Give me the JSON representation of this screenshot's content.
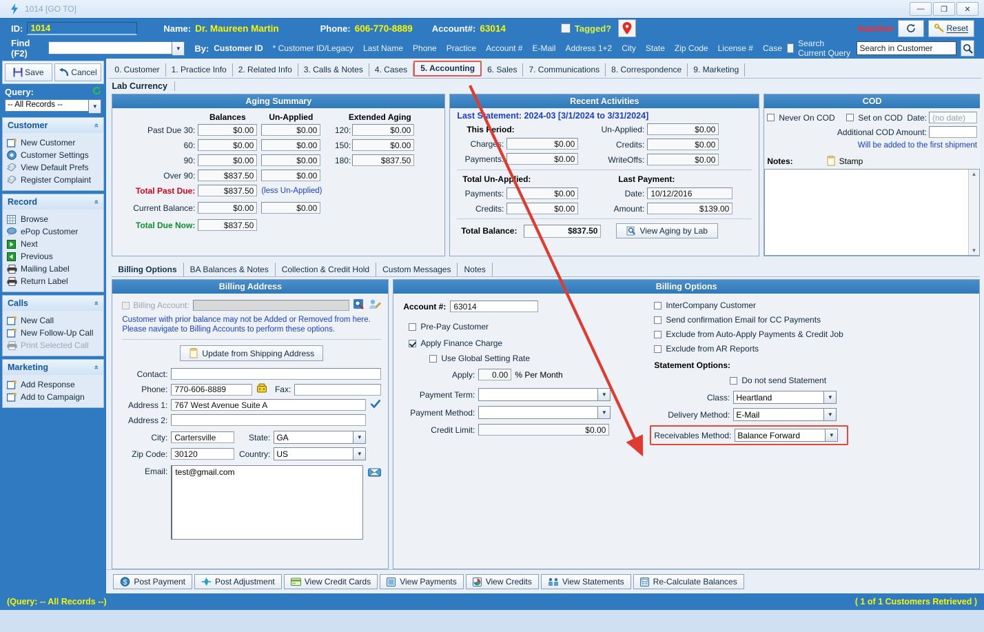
{
  "window": {
    "title": "1014 [GO TO]",
    "minimize": "—",
    "maximize": "❐",
    "close": "✕"
  },
  "header": {
    "id_label": "ID:",
    "id_value": "1014",
    "name_label": "Name:",
    "name_value": "Dr. Maureen Martin",
    "phone_label": "Phone:",
    "phone_value": "606-770-8889",
    "account_label": "Account#:",
    "account_value": "63014",
    "tagged_label": "Tagged?",
    "map_icon": "map-pin-icon",
    "status": "Inactive",
    "refresh_icon": "refresh-icon",
    "reset_label": "Reset"
  },
  "findbar": {
    "find_label": "Find (F2)",
    "find_value": "",
    "by_label": "By:",
    "by_options": [
      "Customer ID",
      "* Customer ID/Legacy",
      "Last Name",
      "Phone",
      "Practice",
      "Account #",
      "E-Mail",
      "Address 1+2",
      "City",
      "State",
      "Zip Code",
      "License #",
      "Case"
    ],
    "by_selected": "Customer ID",
    "search_current_query_label": "Search Current Query",
    "search_value": "Search in Customer",
    "search_icon": "magnifier-icon"
  },
  "sidebar": {
    "save_label": "Save",
    "cancel_label": "Cancel",
    "query_label": "Query:",
    "query_refresh_icon": "refresh-icon",
    "query_value": "-- All Records --",
    "groups": [
      {
        "title": "Customer",
        "items": [
          {
            "label": "New Customer",
            "icon": "new-page-icon",
            "dim": false
          },
          {
            "label": "Customer Settings",
            "icon": "gear-blue-icon",
            "dim": false
          },
          {
            "label": "View Default Prefs",
            "icon": "pages-icon",
            "dim": false
          },
          {
            "label": "Register Complaint",
            "icon": "pages-icon",
            "dim": false
          }
        ]
      },
      {
        "title": "Record",
        "items": [
          {
            "label": "Browse",
            "icon": "grid-icon",
            "dim": false
          },
          {
            "label": "ePop Customer",
            "icon": "speech-bubble-icon",
            "dim": false
          },
          {
            "label": "Next",
            "icon": "next-arrow-icon",
            "dim": false
          },
          {
            "label": "Previous",
            "icon": "previous-arrow-icon",
            "dim": false
          },
          {
            "label": "Mailing Label",
            "icon": "printer-icon",
            "dim": false
          },
          {
            "label": "Return Label",
            "icon": "printer-icon",
            "dim": false
          }
        ]
      },
      {
        "title": "Calls",
        "items": [
          {
            "label": "New Call",
            "icon": "new-page-icon",
            "dim": false
          },
          {
            "label": "New Follow-Up Call",
            "icon": "new-page-icon",
            "dim": false
          },
          {
            "label": "Print Selected Call",
            "icon": "printer-icon",
            "dim": true
          }
        ]
      },
      {
        "title": "Marketing",
        "items": [
          {
            "label": "Add Response",
            "icon": "new-page-icon",
            "dim": false
          },
          {
            "label": "Add to Campaign",
            "icon": "new-page-icon",
            "dim": false
          }
        ]
      }
    ]
  },
  "tabs": [
    {
      "label": "0. Customer",
      "active": false
    },
    {
      "label": "1. Practice Info",
      "active": false
    },
    {
      "label": "2. Related Info",
      "active": false
    },
    {
      "label": "3. Calls & Notes",
      "active": false
    },
    {
      "label": "4. Cases",
      "active": false
    },
    {
      "label": "5. Accounting",
      "active": true
    },
    {
      "label": "6. Sales",
      "active": false
    },
    {
      "label": "7. Communications",
      "active": false
    },
    {
      "label": "8. Correspondence",
      "active": false
    },
    {
      "label": "9. Marketing",
      "active": false
    }
  ],
  "lab_currency_tab": "Lab Currency",
  "aging": {
    "title": "Aging Summary",
    "col_balances": "Balances",
    "col_unapplied": "Un-Applied",
    "col_extended": "Extended Aging",
    "rows": [
      {
        "label": "Past Due 30:",
        "balance": "$0.00",
        "unapplied": "$0.00"
      },
      {
        "label": "60:",
        "balance": "$0.00",
        "unapplied": "$0.00"
      },
      {
        "label": "90:",
        "balance": "$0.00",
        "unapplied": "$0.00"
      },
      {
        "label": "Over 90:",
        "balance": "$837.50",
        "unapplied": "$0.00"
      }
    ],
    "extended": [
      {
        "label": "120:",
        "value": "$0.00"
      },
      {
        "label": "150:",
        "value": "$0.00"
      },
      {
        "label": "180:",
        "value": "$837.50"
      }
    ],
    "total_past_due_label": "Total Past Due:",
    "total_past_due_value": "$837.50",
    "less_unapplied_note": "(less Un-Applied)",
    "current_balance_label": "Current Balance:",
    "current_balance_value": "$0.00",
    "current_balance_unapplied": "$0.00",
    "total_due_now_label": "Total Due Now:",
    "total_due_now_value": "$837.50"
  },
  "recent": {
    "title": "Recent Activities",
    "last_statement": "Last Statement: 2024-03  [3/1/2024 to 3/31/2024]",
    "this_period_label": "This Period:",
    "charges_label": "Charges:",
    "charges_value": "$0.00",
    "payments_label": "Payments:",
    "payments_value": "$0.00",
    "unapplied_label": "Un-Applied:",
    "unapplied_value": "$0.00",
    "credits_label": "Credits:",
    "credits_value": "$0.00",
    "writeoffs_label": "WriteOffs:",
    "writeoffs_value": "$0.00",
    "total_unapplied_label": "Total Un-Applied:",
    "tu_payments_label": "Payments:",
    "tu_payments_value": "$0.00",
    "tu_credits_label": "Credits:",
    "tu_credits_value": "$0.00",
    "last_payment_label": "Last Payment:",
    "lp_date_label": "Date:",
    "lp_date_value": "10/12/2016",
    "lp_amount_label": "Amount:",
    "lp_amount_value": "$139.00",
    "total_balance_label": "Total Balance:",
    "total_balance_value": "$837.50",
    "view_aging_label": "View Aging by Lab"
  },
  "cod": {
    "title": "COD",
    "never_on_cod": "Never On COD",
    "set_on_cod": "Set on COD",
    "date_label": "Date:",
    "date_value": "(no date)",
    "additional_label": "Additional COD Amount:",
    "additional_value": "",
    "note": "Will be added to the first shipment",
    "notes_label": "Notes:",
    "stamp_label": "Stamp",
    "notes_value": ""
  },
  "subtabs": [
    {
      "label": "Billing Options",
      "active": true
    },
    {
      "label": "BA Balances & Notes",
      "active": false
    },
    {
      "label": "Collection & Credit Hold",
      "active": false
    },
    {
      "label": "Custom Messages",
      "active": false
    },
    {
      "label": "Notes",
      "active": false
    }
  ],
  "billing_address": {
    "title": "Billing Address",
    "billing_account_label": "Billing Account:",
    "billing_account_value": "",
    "icon1": "search-customer-icon",
    "icon2": "person-edit-icon",
    "warning_line1": "Customer with prior balance may not be Added or Removed from here.",
    "warning_line2": "Please navigate to Billing Accounts to perform these options.",
    "update_btn": "Update from Shipping Address",
    "contact_label": "Contact:",
    "contact_value": "",
    "phone_label": "Phone:",
    "phone_value": "770-606-8889",
    "phone_icon": "telephone-icon",
    "fax_label": "Fax:",
    "fax_value": "",
    "address1_label": "Address 1:",
    "address1_value": "767 West Avenue Suite A",
    "address1_valid_icon": "checkmark-icon",
    "address2_label": "Address 2:",
    "address2_value": "",
    "city_label": "City:",
    "city_value": "Cartersville",
    "state_label": "State:",
    "state_value": "GA",
    "zip_label": "Zip Code:",
    "zip_value": "30120",
    "country_label": "Country:",
    "country_value": "US",
    "email_label": "Email:",
    "email_value": "test@gmail.com",
    "email_icon": "envelope-icon"
  },
  "billing_options": {
    "title": "Billing Options",
    "account_label": "Account #:",
    "account_value": "63014",
    "prepay_label": "Pre-Pay Customer",
    "prepay_checked": false,
    "finance_label": "Apply Finance Charge",
    "finance_checked": true,
    "global_rate_label": "Use Global Setting Rate",
    "global_rate_checked": false,
    "apply_label": "Apply:",
    "apply_value": "0.00",
    "apply_suffix": "% Per Month",
    "payment_term_label": "Payment Term:",
    "payment_term_value": "",
    "payment_method_label": "Payment Method:",
    "payment_method_value": "",
    "credit_limit_label": "Credit Limit:",
    "credit_limit_value": "$0.00",
    "checks": [
      {
        "label": "InterCompany Customer",
        "checked": false
      },
      {
        "label": "Send confirmation Email for CC Payments",
        "checked": false
      },
      {
        "label": "Exclude from Auto-Apply Payments & Credit Job",
        "checked": false
      },
      {
        "label": "Exclude from AR Reports",
        "checked": false
      }
    ],
    "statement_options_label": "Statement Options:",
    "do_not_send_label": "Do not send Statement",
    "do_not_send_checked": false,
    "class_label": "Class:",
    "class_value": "Heartland",
    "delivery_label": "Delivery Method:",
    "delivery_value": "E-Mail",
    "receivables_label": "Receivables Method:",
    "receivables_value": "Balance Forward"
  },
  "bottom_buttons": [
    {
      "label": "Post Payment",
      "icon": "money-icon"
    },
    {
      "label": "Post Adjustment",
      "icon": "adjust-icon"
    },
    {
      "label": "View Credit Cards",
      "icon": "credit-card-icon"
    },
    {
      "label": "View Payments",
      "icon": "payments-icon"
    },
    {
      "label": "View Credits",
      "icon": "credits-icon"
    },
    {
      "label": "View Statements",
      "icon": "statements-icon"
    },
    {
      "label": "Re-Calculate Balances",
      "icon": "recalc-icon"
    }
  ],
  "statusbar": {
    "left": "(Query: -- All Records --)",
    "right": "( 1 of 1 Customers Retrieved )"
  },
  "annotation": {
    "arrow_color": "#e03b2f",
    "highlight_color": "#e8473a"
  }
}
